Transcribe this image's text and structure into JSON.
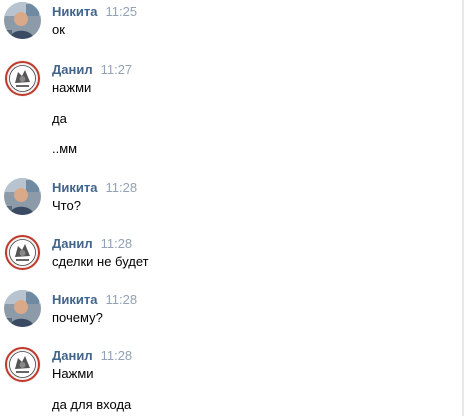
{
  "messages": [
    {
      "author": "Никита",
      "avatar_icon": "user-photo-avatar",
      "time": "11:25",
      "lines": [
        "ок"
      ]
    },
    {
      "author": "Данил",
      "avatar_icon": "emblem-avatar",
      "time": "11:27",
      "lines": [
        "нажми",
        "да",
        "..мм"
      ]
    },
    {
      "author": "Никита",
      "avatar_icon": "user-photo-avatar",
      "time": "11:28",
      "lines": [
        "Что?"
      ]
    },
    {
      "author": "Данил",
      "avatar_icon": "emblem-avatar",
      "time": "11:28",
      "lines": [
        "сделки не будет"
      ]
    },
    {
      "author": "Никита",
      "avatar_icon": "user-photo-avatar",
      "time": "11:28",
      "lines": [
        "почему?"
      ]
    },
    {
      "author": "Данил",
      "avatar_icon": "emblem-avatar",
      "time": "11:28",
      "lines": [
        "Нажми",
        "да для входа"
      ]
    }
  ],
  "colors": {
    "author_name": "#42648b",
    "timestamp": "#93a3b5",
    "text": "#000000",
    "background": "#ffffff"
  }
}
